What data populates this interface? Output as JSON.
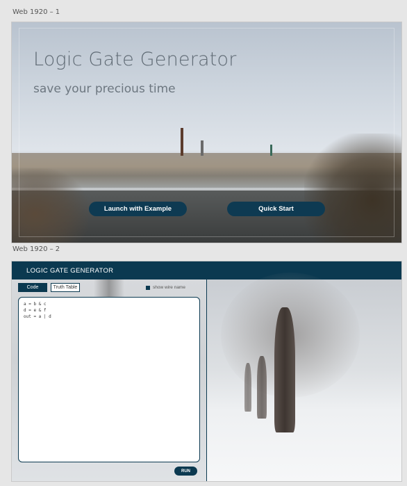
{
  "artboards": [
    {
      "label": "Web 1920 – 1"
    },
    {
      "label": "Web 1920 – 2"
    }
  ],
  "landing": {
    "title": "Logic Gate Generator",
    "subtitle": "save your precious time",
    "buttons": {
      "launch_example": "Launch with Example",
      "quick_start": "Quick Start"
    }
  },
  "app": {
    "header_title": "LOGIC GATE GENERATOR",
    "tabs": [
      {
        "label": "Code",
        "active": true
      },
      {
        "label": "Truth Table",
        "active": false
      }
    ],
    "show_wire_name": {
      "label": "show wire name",
      "checked": true
    },
    "code_lines": [
      "a = b & c",
      "d = e & f",
      "out = a | d"
    ],
    "run_label": "RUN"
  },
  "colors": {
    "accent": "#0b3950",
    "background": "#e6e6e6"
  }
}
